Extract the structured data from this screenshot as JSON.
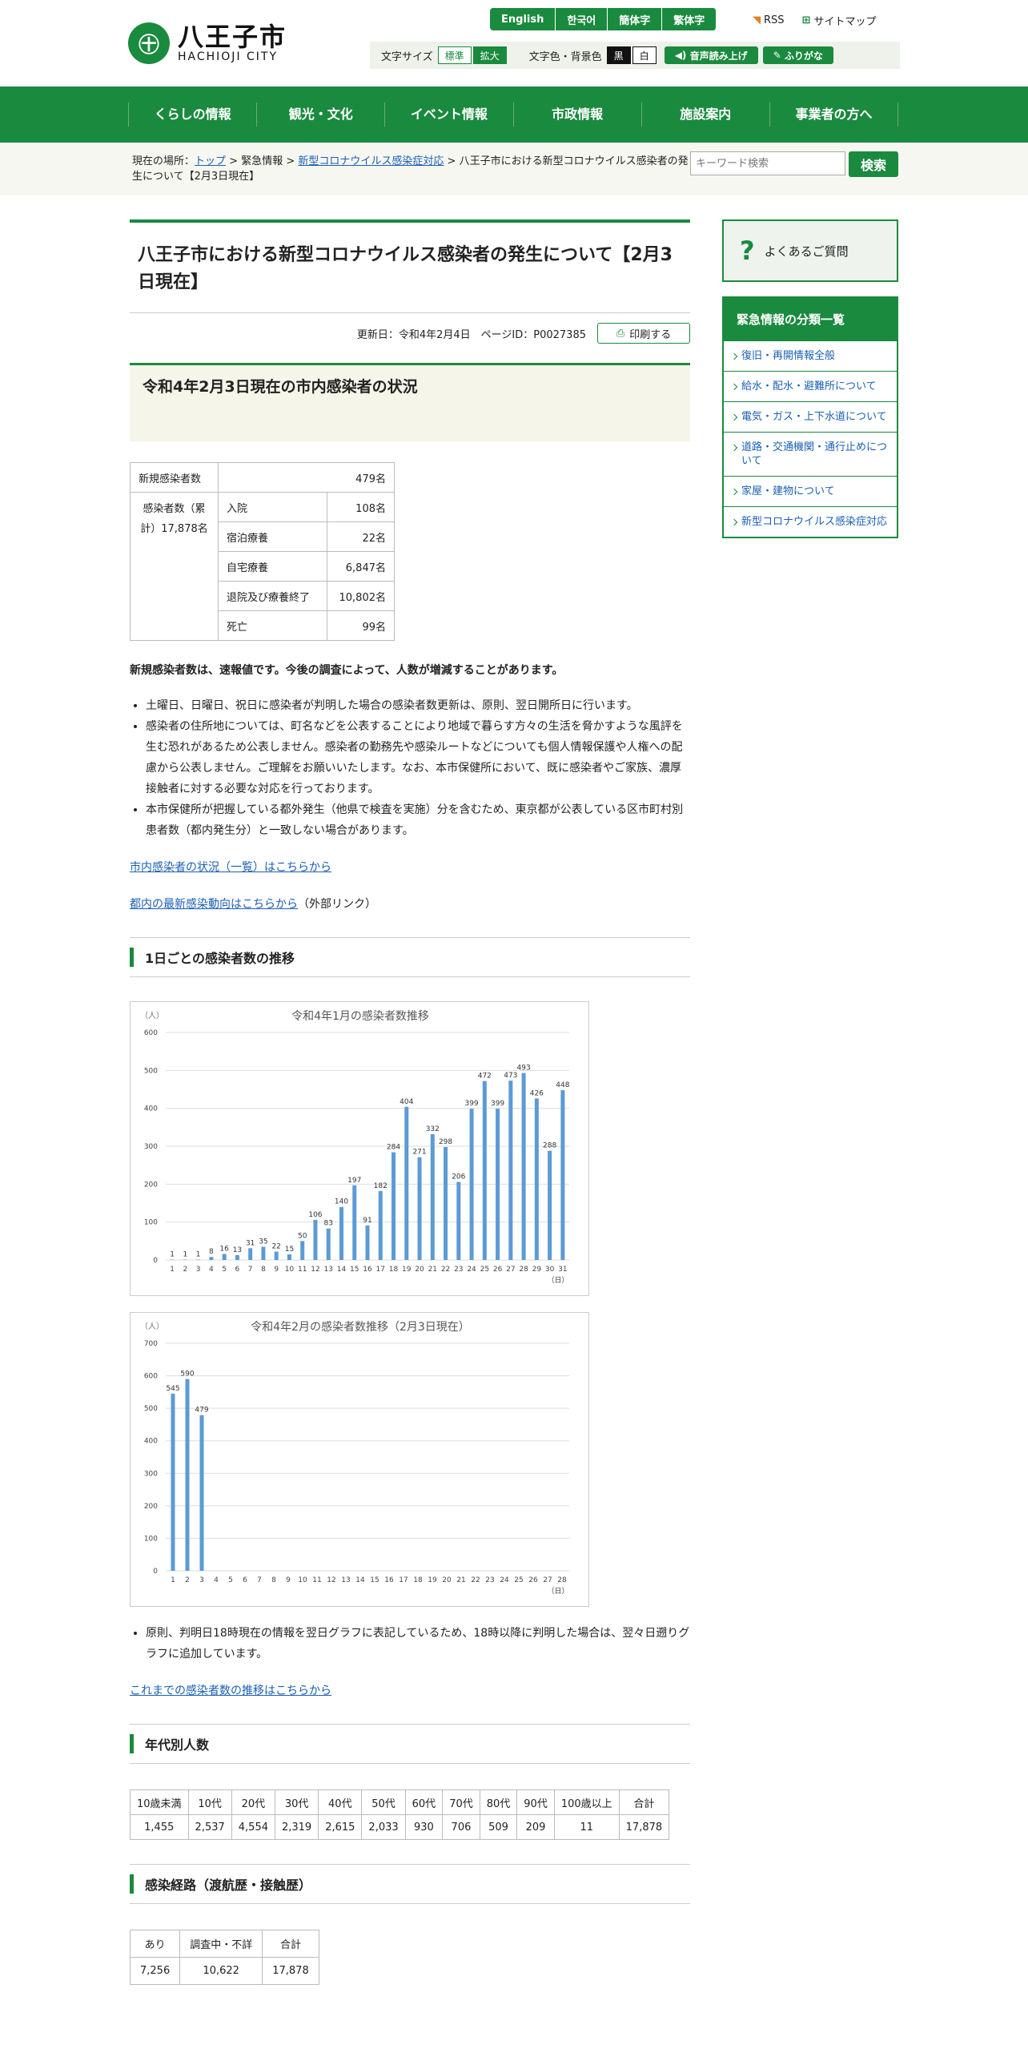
{
  "site": {
    "name_ja": "八王子市",
    "name_en": "HACHIOJI CITY",
    "mark": "㊉"
  },
  "languages": [
    "English",
    "한국어",
    "簡体字",
    "繁体字"
  ],
  "toplinks": {
    "rss": "RSS",
    "sitemap": "サイトマップ"
  },
  "toolbar": {
    "font_label": "文字サイズ",
    "std": "標準",
    "big": "拡大",
    "color_label": "文字色・背景色",
    "black": "黒",
    "white": "白",
    "voice": "音声読み上げ",
    "furigana": "ふりがな"
  },
  "nav": [
    "くらしの情報",
    "観光・文化",
    "イベント情報",
    "市政情報",
    "施設案内",
    "事業者の方へ"
  ],
  "breadcrumb": {
    "prefix": "現在の場所：",
    "top": "トップ",
    "sep1": " > ",
    "emergency": "緊急情報",
    "sep2": " > ",
    "corona": "新型コロナウイルス感染症対応",
    "sep3": " > ",
    "current": "八王子市における新型コロナウイルス感染者の発生について【2月3日現在】"
  },
  "search": {
    "placeholder": "キーワード検索",
    "button": "検索"
  },
  "page": {
    "title": "八王子市における新型コロナウイルス感染者の発生について【2月3日現在】",
    "updated": "更新日：令和4年2月4日　ページID：P0027385",
    "print": "印刷する",
    "h2": "令和4年2月3日現在の市内感染者の状況"
  },
  "summary": {
    "new_label": "新規感染者数",
    "new_value": "479名",
    "cum_label": "感染者数（累計）17,878名",
    "rows": [
      {
        "label": "入院",
        "value": "108名"
      },
      {
        "label": "宿泊療養",
        "value": "22名"
      },
      {
        "label": "自宅療養",
        "value": "6,847名"
      },
      {
        "label": "退院及び療養終了",
        "value": "10,802名"
      },
      {
        "label": "死亡",
        "value": "99名"
      }
    ]
  },
  "notice": "新規感染者数は、速報値です。今後の調査によって、人数が増減することがあります。",
  "bullets": [
    "土曜日、日曜日、祝日に感染者が判明した場合の感染者数更新は、原則、翌日開所日に行います。",
    "感染者の住所地については、町名などを公表することにより地域で暮らす方々の生活を脅かすような風評を生む恐れがあるため公表しません。感染者の勤務先や感染ルートなどについても個人情報保護や人権への配慮から公表しません。ご理解をお願いいたします。なお、本市保健所において、既に感染者やご家族、濃厚接触者に対する必要な対応を行っております。",
    "本市保健所が把握している都外発生（他県で検査を実施）分を含むため、東京都が公表している区市町村別患者数（都内発生分）と一致しない場合があります。"
  ],
  "links": {
    "list": "市内感染者の状況（一覧）はこちらから",
    "tokyo": "都内の最新感染動向はこちらから",
    "external": "（外部リンク）",
    "history": "これまでの感染者数の推移はこちらから"
  },
  "section_daily": "1日ごとの感染者数の推移",
  "chart_note": "原則、判明日18時現在の情報を翌日グラフに表記しているため、18時以降に判明した場合は、翌々日遡りグラフに追加しています。",
  "section_age": "年代別人数",
  "age": {
    "headers": [
      "10歳未満",
      "10代",
      "20代",
      "30代",
      "40代",
      "50代",
      "60代",
      "70代",
      "80代",
      "90代",
      "100歳以上",
      "合計"
    ],
    "values": [
      "1,455",
      "2,537",
      "4,554",
      "2,319",
      "2,615",
      "2,033",
      "930",
      "706",
      "509",
      "209",
      "11",
      "17,878"
    ]
  },
  "section_route": "感染経路（渡航歴・接触歴）",
  "route": {
    "headers": [
      "あり",
      "調査中・不詳",
      "合計"
    ],
    "values": [
      "7,256",
      "10,622",
      "17,878"
    ]
  },
  "side": {
    "faq": "よくあるご質問",
    "cat_head": "緊急情報の分類一覧",
    "items": [
      "復旧・再開情報全般",
      "給水・配水・避難所について",
      "電気・ガス・上下水道について",
      "道路・交通機関・通行止めについて",
      "家屋・建物について",
      "新型コロナウイルス感染症対応"
    ]
  },
  "colors": {
    "brand": "#1a8a3e",
    "bar": "#5b9bd5"
  },
  "chart_data": [
    {
      "type": "bar",
      "title": "令和4年1月の感染者数推移",
      "ylabel": "（人）",
      "xunit": "（日）",
      "ylim": [
        0,
        600
      ],
      "yticks": [
        0,
        100,
        200,
        300,
        400,
        500,
        600
      ],
      "categories": [
        "1",
        "2",
        "3",
        "4",
        "5",
        "6",
        "7",
        "8",
        "9",
        "10",
        "11",
        "12",
        "13",
        "14",
        "15",
        "16",
        "17",
        "18",
        "19",
        "20",
        "21",
        "22",
        "23",
        "24",
        "25",
        "26",
        "27",
        "28",
        "29",
        "30",
        "31"
      ],
      "values": [
        1,
        1,
        1,
        8,
        16,
        13,
        31,
        35,
        22,
        15,
        50,
        106,
        83,
        140,
        197,
        91,
        182,
        284,
        404,
        271,
        332,
        298,
        206,
        399,
        472,
        399,
        473,
        493,
        426,
        288,
        448
      ]
    },
    {
      "type": "bar",
      "title": "令和4年2月の感染者数推移（2月3日現在）",
      "ylabel": "（人）",
      "xunit": "（日）",
      "ylim": [
        0,
        700
      ],
      "yticks": [
        0,
        100,
        200,
        300,
        400,
        500,
        600,
        700
      ],
      "categories": [
        "1",
        "2",
        "3",
        "4",
        "5",
        "6",
        "7",
        "8",
        "9",
        "10",
        "11",
        "12",
        "13",
        "14",
        "15",
        "16",
        "17",
        "18",
        "19",
        "20",
        "21",
        "22",
        "23",
        "24",
        "25",
        "26",
        "27",
        "28"
      ],
      "values": [
        545,
        590,
        479,
        null,
        null,
        null,
        null,
        null,
        null,
        null,
        null,
        null,
        null,
        null,
        null,
        null,
        null,
        null,
        null,
        null,
        null,
        null,
        null,
        null,
        null,
        null,
        null,
        null
      ]
    }
  ]
}
